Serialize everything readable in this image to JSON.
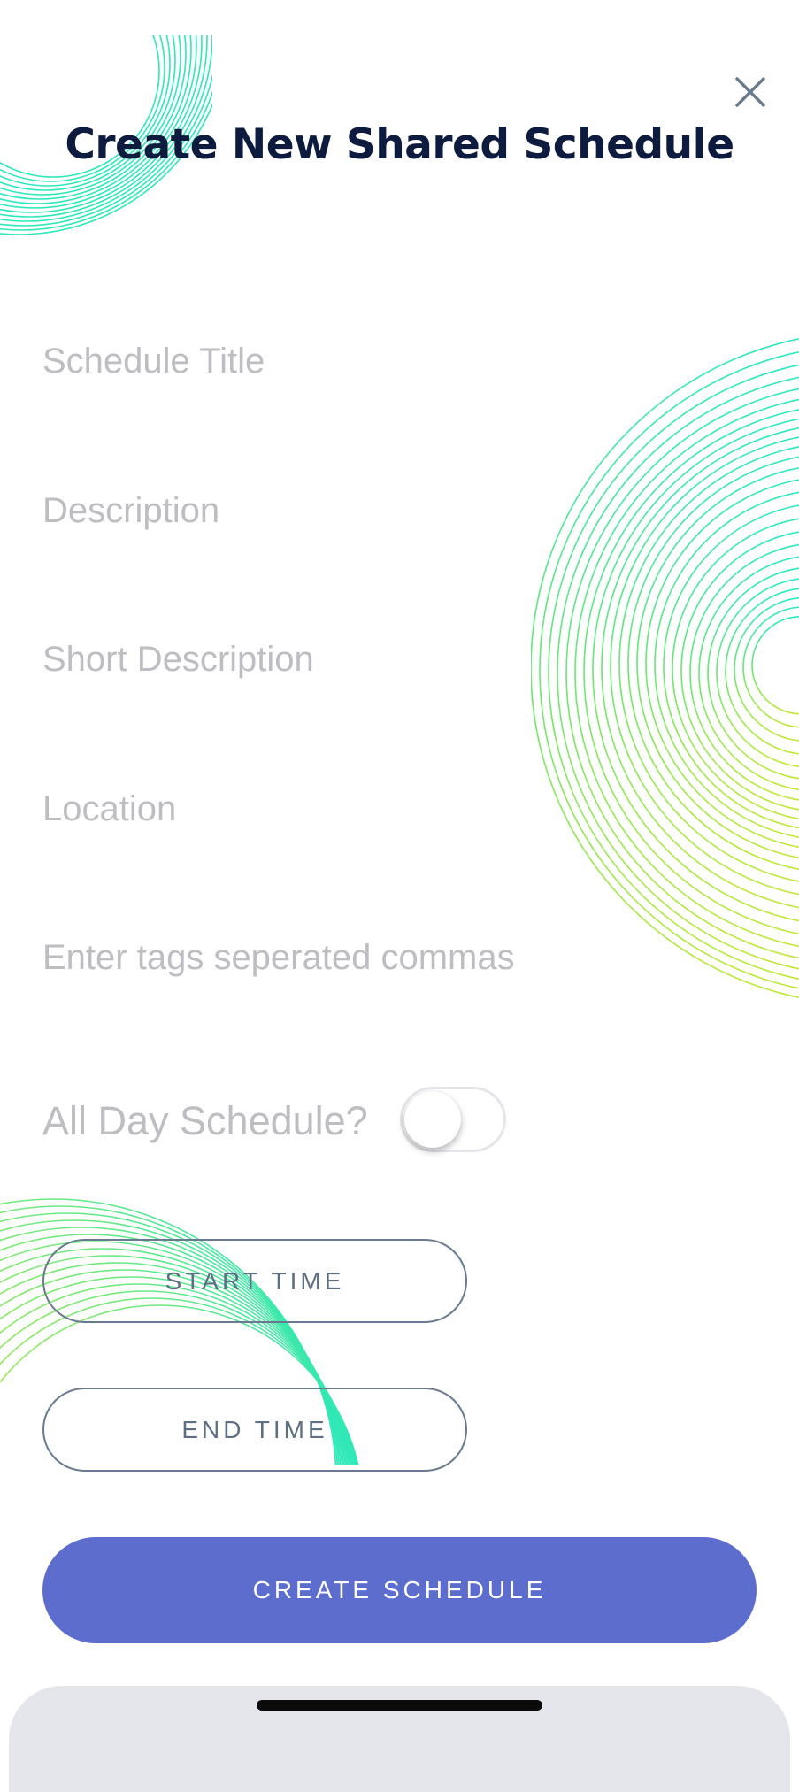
{
  "header": {
    "title": "Create New Shared Schedule",
    "close_icon": "close-icon"
  },
  "form": {
    "title_placeholder": "Schedule Title",
    "description_placeholder": "Description",
    "short_description_placeholder": "Short Description",
    "location_placeholder": "Location",
    "tags_placeholder": "Enter tags seperated commas",
    "all_day_label": "All Day Schedule?",
    "all_day_enabled": false
  },
  "buttons": {
    "start_time": "START TIME",
    "end_time": "END TIME",
    "create": "CREATE SCHEDULE"
  },
  "colors": {
    "title": "#0d1b3e",
    "primary": "#5c6dcd",
    "outline": "#6a7a8e",
    "placeholder": "#bdbdc2",
    "decoration_start": "#2de8c4",
    "decoration_end": "#b4e83a"
  }
}
